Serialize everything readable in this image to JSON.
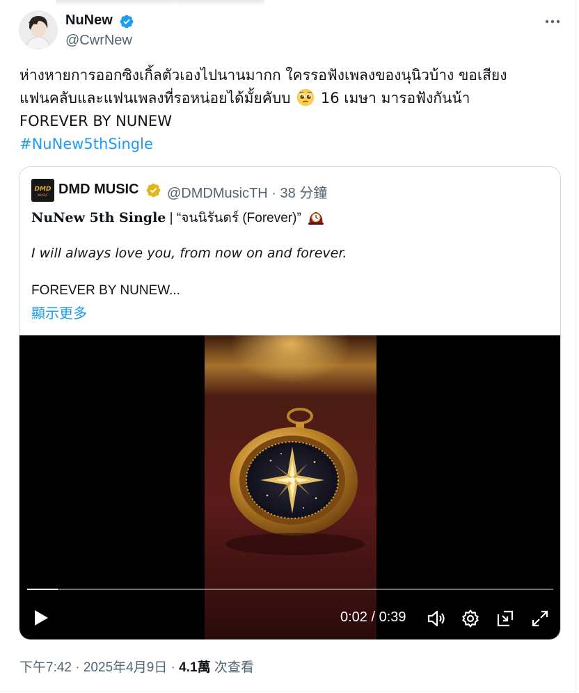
{
  "author": {
    "display_name": "NuNew",
    "handle": "@CwrNew"
  },
  "tweet": {
    "line1": "ห่างหายการออกซิงเกิ้ลตัวเองไปนานมากก ใครรอฟังเพลงของนุนิวบ้าง ขอเสียง",
    "line2_before_emoji": "แฟนคลับและแฟนเพลงที่รอหน่อยได้มั้ยคับบ",
    "line2_after_emoji": "16 เมษา มารอฟังกันน้า",
    "line3": "FOREVER BY NUNEW",
    "hashtag": "#NuNew5thSingle",
    "emoji": "pleading-face-emoji"
  },
  "quote": {
    "logo_text": "DMD",
    "logo_subtext": "MUSIC",
    "name": "DMD MUSIC",
    "meta": "@DMDMusicTH · 38 分鐘",
    "line1_bold": "NuNew 5th Single",
    "line1_rest": " | “จนนิรันดร์ (Forever)”",
    "line2": "I will always love you, from now on and forever.",
    "line3": "FOREVER BY NUNEW...",
    "show_more": "顯示更多",
    "clock_icon": "mantelpiece-clock-icon"
  },
  "video": {
    "time": "0:02 / 0:39",
    "progress": 0.058,
    "icons": [
      "play-icon",
      "volume-icon",
      "settings-icon",
      "picture-in-picture-icon",
      "fullscreen-icon"
    ]
  },
  "footer": {
    "timestamp": "下午7:42 · 2025年4月9日 · ",
    "views_count": "4.1萬",
    "views_label": " 次查看"
  },
  "colors": {
    "accent": "#1d9bf0",
    "verified_blue": "#1d9bf0",
    "verified_gold": "#e2b719",
    "muted": "#536471",
    "text": "#0f1419",
    "border": "#cfd9de"
  }
}
